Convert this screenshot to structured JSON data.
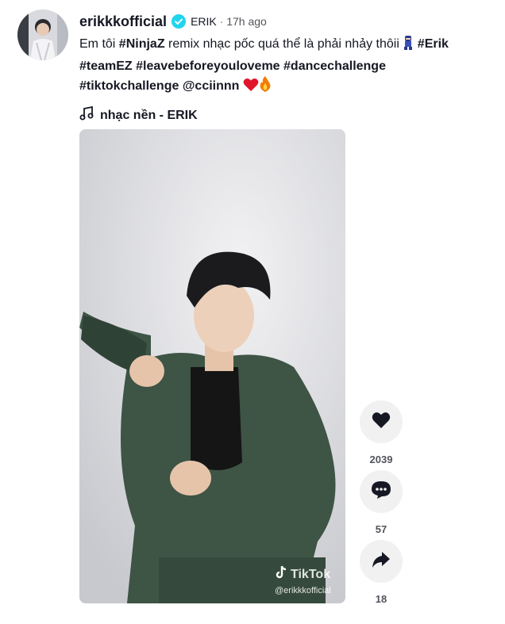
{
  "post": {
    "username": "erikkkofficial",
    "nickname": "ERIK",
    "separator": "·",
    "time": "17h ago",
    "caption": {
      "line1_text": "Em tôi ",
      "line1_tag": "#NinjaZ",
      "line1_rest": " remix nhạc pốc quá thể là phải nhảy thôii ",
      "line1_tag2": "#Erik",
      "line2_tags": [
        "#teamEZ",
        "#leavebeforeyouloveme",
        "#dancechallenge"
      ],
      "line3_tag": "#tiktokchallenge",
      "line3_mention": "@cciinnn"
    },
    "music": "nhạc nền - ERIK"
  },
  "video": {
    "watermark_brand": "TikTok",
    "watermark_user": "@erikkkofficial"
  },
  "actions": {
    "like_count": "2039",
    "comment_count": "57",
    "share_count": "18"
  },
  "icons": {
    "verified": "verified-badge-icon",
    "music": "music-note-icon",
    "like": "heart-icon",
    "comment": "comment-icon",
    "share": "share-icon"
  },
  "colors": {
    "verified": "#20d5ec",
    "text": "#161823",
    "action_bg": "#f1f1f2"
  }
}
